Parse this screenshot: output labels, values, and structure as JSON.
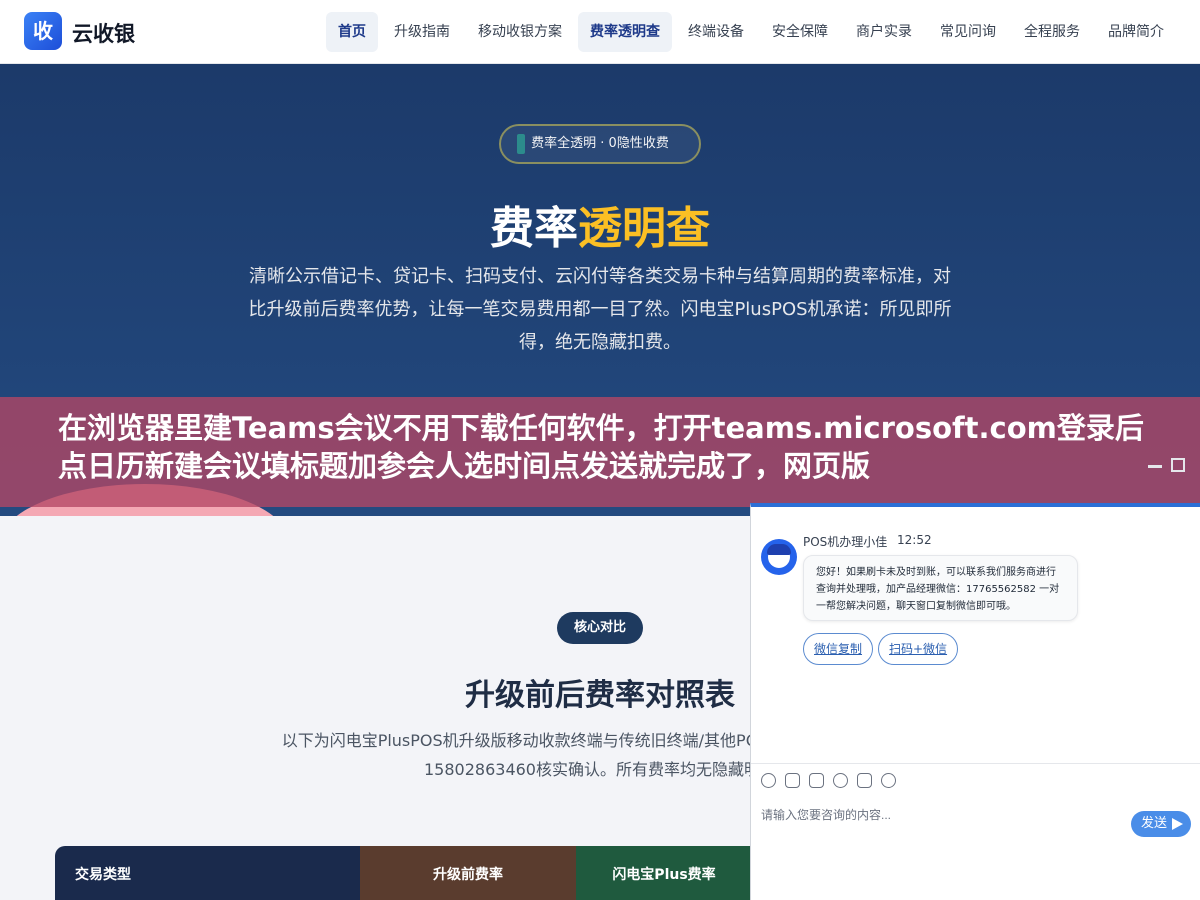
{
  "header": {
    "logo_char": "收",
    "brand": "云收银",
    "nav": [
      {
        "label": "首页",
        "active": true
      },
      {
        "label": "升级指南",
        "active": false
      },
      {
        "label": "移动收银方案",
        "active": false
      },
      {
        "label": "费率透明查",
        "active": true
      },
      {
        "label": "终端设备",
        "active": false
      },
      {
        "label": "安全保障",
        "active": false
      },
      {
        "label": "商户实录",
        "active": false
      },
      {
        "label": "常见问询",
        "active": false
      },
      {
        "label": "全程服务",
        "active": false
      },
      {
        "label": "品牌简介",
        "active": false
      }
    ]
  },
  "hero": {
    "badge": "费率全透明 · 0隐性收费",
    "title_plain": "费率",
    "title_highlight": "透明查",
    "description": "清晰公示借记卡、贷记卡、扫码支付、云闪付等各类交易卡种与结算周期的费率标准，对比升级前后费率优势，让每一笔交易费用都一目了然。闪电宝PlusPOS机承诺：所见即所得，绝无隐藏扣费。"
  },
  "caption": {
    "text": "在浏览器里建Teams会议不用下载任何软件，打开teams.microsoft.com登录后点日历新建会议填标题加参会人选时间点发送就完成了，网页版"
  },
  "comparison": {
    "badge": "核心对比",
    "title": "升级前后费率对照表",
    "description": "以下为闪电宝PlusPOS机升级版移动收款终端与传统旧终端/其他PO据真实可查，欢迎致电15802863460核实确认。所有费率均无隐藏明。",
    "table_headers": [
      "交易类型",
      "升级前费率",
      "闪电宝Plus费率"
    ]
  },
  "chat": {
    "sender": "POS机办理小佳",
    "time": "12:52",
    "message": "您好！如果刷卡未及时到账，可以联系我们服务商进行查询并处理哦，加产品经理微信：17765562582 一对一帮您解决问题，聊天窗口复制微信即可哦。",
    "buttons": [
      "微信复制",
      "扫码+微信"
    ],
    "input_placeholder": "请输入您要咨询的内容...",
    "send_label": "发送",
    "tools": [
      "emoji-icon",
      "image-icon",
      "screenshot-icon",
      "rating-icon",
      "voice-icon",
      "chat-bubbles-icon"
    ]
  }
}
